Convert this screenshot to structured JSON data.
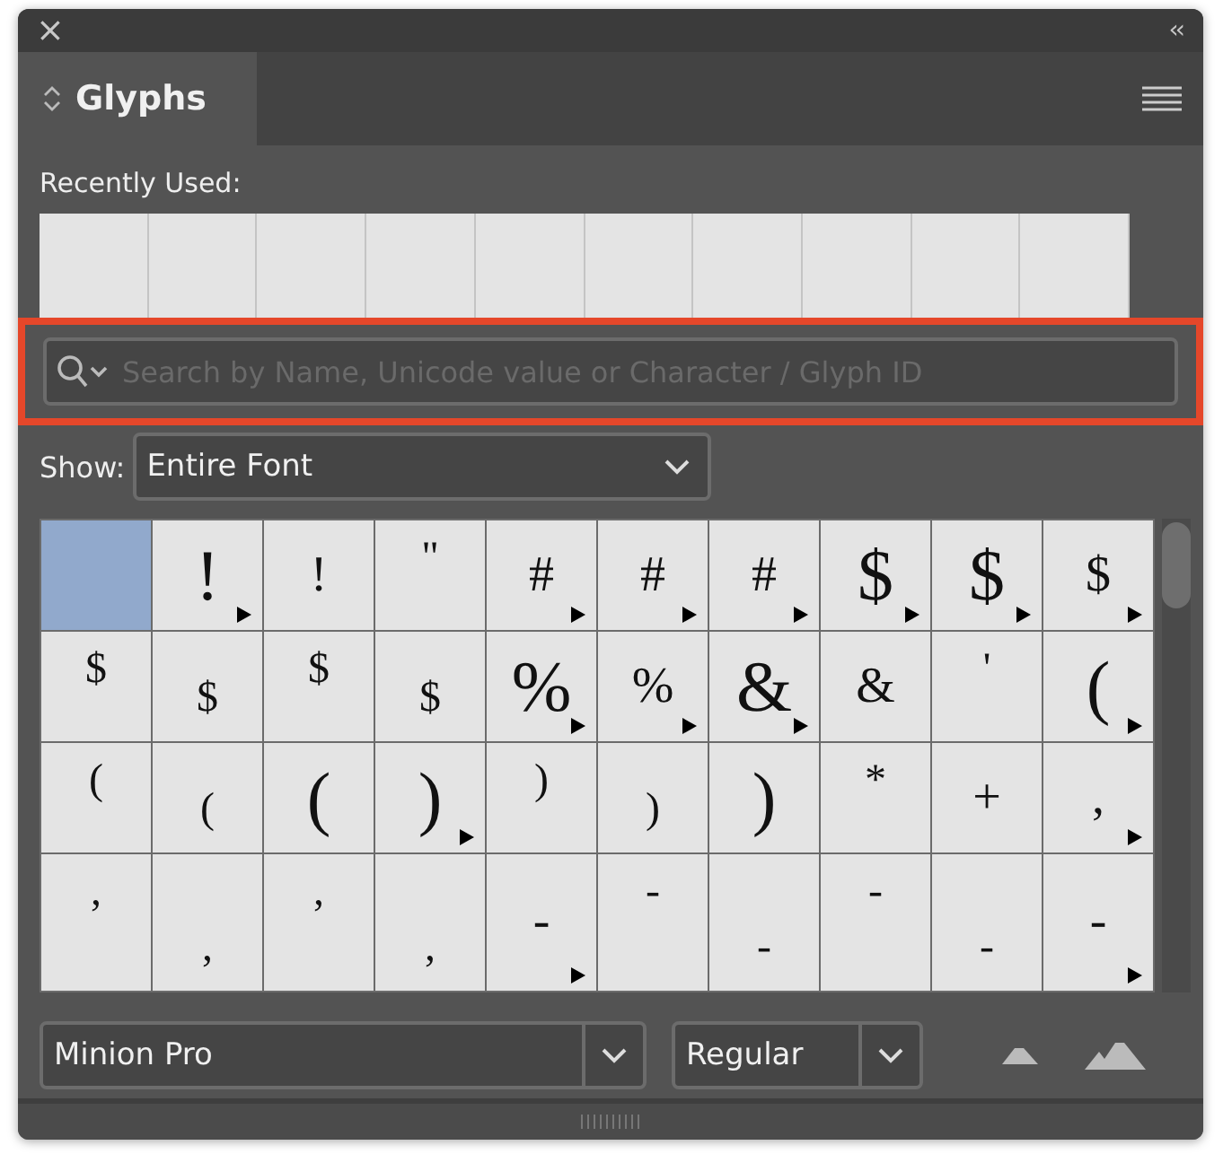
{
  "window": {
    "close": "×",
    "collapse": "‹‹"
  },
  "tab": {
    "label": "Glyphs",
    "selected": true
  },
  "recently_used": {
    "label": "Recently Used:"
  },
  "search": {
    "placeholder": "Search by Name, Unicode value or Character / Glyph ID",
    "highlighted": true
  },
  "show": {
    "label": "Show:",
    "value": "Entire Font"
  },
  "glyphs": [
    {
      "selected": true
    },
    {
      "char": "!",
      "kind": "large",
      "alternates": true,
      "selected": false
    },
    {
      "char": "!",
      "kind": "normal",
      "alternates": false,
      "selected": false
    },
    {
      "char": "\"",
      "kind": "raised",
      "alternates": false,
      "selected": false
    },
    {
      "char": "#",
      "kind": "normal",
      "alternates": true,
      "selected": false
    },
    {
      "char": "#",
      "kind": "normal",
      "alternates": true,
      "selected": false
    },
    {
      "char": "#",
      "kind": "normal",
      "alternates": true,
      "selected": false
    },
    {
      "char": "$",
      "kind": "large",
      "alternates": true,
      "selected": false
    },
    {
      "char": "$",
      "kind": "large",
      "alternates": true,
      "selected": false
    },
    {
      "char": "$",
      "kind": "normal",
      "alternates": true,
      "selected": false
    },
    {
      "char": "$",
      "kind": "raised",
      "alternates": false,
      "selected": false
    },
    {
      "char": "$",
      "kind": "lowered",
      "alternates": false,
      "selected": false
    },
    {
      "char": "$",
      "kind": "raised",
      "alternates": false,
      "selected": false
    },
    {
      "char": "$",
      "kind": "lowered",
      "alternates": false,
      "selected": false
    },
    {
      "char": "%",
      "kind": "large",
      "alternates": true,
      "selected": false
    },
    {
      "char": "%",
      "kind": "normal",
      "alternates": true,
      "selected": false
    },
    {
      "char": "&",
      "kind": "large",
      "alternates": true,
      "selected": false
    },
    {
      "char": "&",
      "kind": "normal",
      "alternates": false,
      "selected": false
    },
    {
      "char": "'",
      "kind": "raised",
      "alternates": false,
      "selected": false
    },
    {
      "char": "(",
      "kind": "large",
      "alternates": true,
      "selected": false
    },
    {
      "char": "(",
      "kind": "raised",
      "alternates": false,
      "selected": false
    },
    {
      "char": "(",
      "kind": "lowered",
      "alternates": false,
      "selected": false
    },
    {
      "char": "(",
      "kind": "large",
      "alternates": false,
      "selected": false
    },
    {
      "char": ")",
      "kind": "large",
      "alternates": true,
      "selected": false
    },
    {
      "char": ")",
      "kind": "raised",
      "alternates": false,
      "selected": false
    },
    {
      "char": ")",
      "kind": "lowered",
      "alternates": false,
      "selected": false
    },
    {
      "char": ")",
      "kind": "large",
      "alternates": false,
      "selected": false
    },
    {
      "char": "*",
      "kind": "raised",
      "alternates": false,
      "selected": false
    },
    {
      "char": "+",
      "kind": "normal",
      "alternates": false,
      "selected": false
    },
    {
      "char": ",",
      "kind": "normal",
      "alternates": true,
      "selected": false
    },
    {
      "char": ",",
      "kind": "raised",
      "alternates": false,
      "selected": false
    },
    {
      "char": ",",
      "kind": "lowered",
      "alternates": false,
      "selected": false
    },
    {
      "char": ",",
      "kind": "raised",
      "alternates": false,
      "selected": false
    },
    {
      "char": ",",
      "kind": "lowered",
      "alternates": false,
      "selected": false
    },
    {
      "char": "-",
      "kind": "normal",
      "alternates": true,
      "selected": false
    },
    {
      "char": "-",
      "kind": "raised",
      "alternates": false,
      "selected": false
    },
    {
      "char": "-",
      "kind": "lowered",
      "alternates": false,
      "selected": false
    },
    {
      "char": "-",
      "kind": "raised",
      "alternates": false,
      "selected": false
    },
    {
      "char": "-",
      "kind": "lowered",
      "alternates": false,
      "selected": false
    },
    {
      "char": "-",
      "kind": "normal",
      "alternates": true,
      "selected": false
    }
  ],
  "font": {
    "family": "Minion Pro",
    "style": "Regular"
  }
}
